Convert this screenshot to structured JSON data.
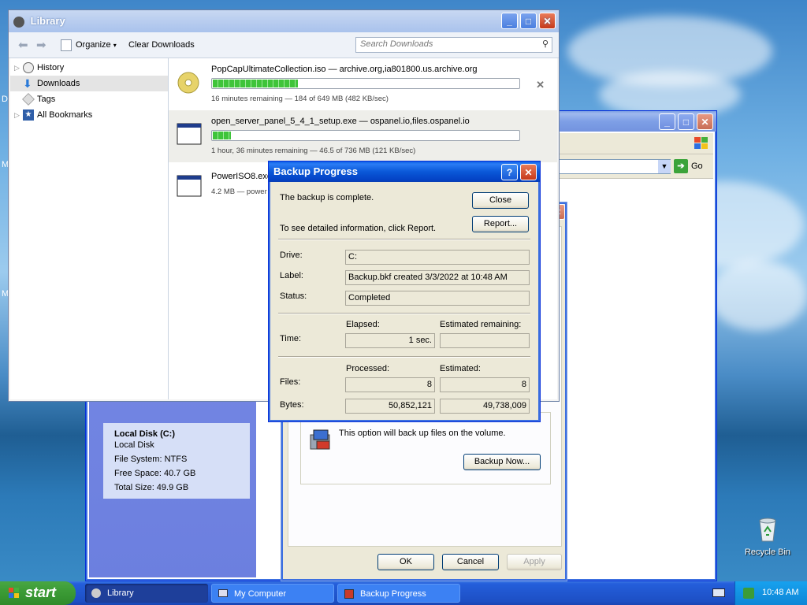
{
  "desktop": {
    "recycle_bin_label": "Recycle Bin",
    "edge_letters": [
      "D",
      "M",
      "M"
    ]
  },
  "library": {
    "title": "Library",
    "toolbar": {
      "organize_label": "Organize",
      "clear_downloads_label": "Clear Downloads",
      "search_placeholder": "Search Downloads"
    },
    "sidebar": [
      {
        "label": "History",
        "icon": "clock-icon",
        "selected": false
      },
      {
        "label": "Downloads",
        "icon": "download-arrow-icon",
        "selected": true
      },
      {
        "label": "Tags",
        "icon": "tag-icon",
        "selected": false
      },
      {
        "label": "All Bookmarks",
        "icon": "bookmark-star-icon",
        "selected": false
      }
    ],
    "downloads": [
      {
        "name": "PopCapUltimateCollection.iso — archive.org,ia801800.us.archive.org",
        "status": "16 minutes remaining — 184 of 649 MB (482 KB/sec)",
        "progress": 0.283,
        "icon": "disc-icon"
      },
      {
        "name": "open_server_panel_5_4_1_setup.exe — ospanel.io,files.ospanel.io",
        "status": "1 hour, 36 minutes remaining — 46.5 of 736 MB (121 KB/sec)",
        "progress": 0.063,
        "icon": "application-window-icon"
      },
      {
        "name": "PowerISO8.exe",
        "status": "4.2 MB — power",
        "progress": null,
        "icon": "application-window-icon"
      }
    ]
  },
  "my_computer": {
    "go_label": "Go",
    "disk": {
      "title": "Local Disk (C:)",
      "type": "Local Disk",
      "file_system": "File System: NTFS",
      "free_space": "Free Space: 40.7 GB",
      "total_size": "Total Size: 49.9 GB"
    }
  },
  "properties": {
    "backup_text": "This option will back up files on the volume.",
    "backup_now_label": "Backup Now...",
    "ok_label": "OK",
    "cancel_label": "Cancel",
    "apply_label": "Apply"
  },
  "backup_dialog": {
    "title": "Backup Progress",
    "complete_text": "The backup is complete.",
    "report_text": "To see detailed information, click Report.",
    "close_label": "Close",
    "report_label": "Report...",
    "drive_label": "Drive:",
    "drive_value": "C:",
    "label_label": "Label:",
    "label_value": "Backup.bkf created 3/3/2022 at 10:48 AM",
    "status_label": "Status:",
    "status_value": "Completed",
    "elapsed_header": "Elapsed:",
    "est_remaining_header": "Estimated remaining:",
    "time_label": "Time:",
    "time_elapsed": "1 sec.",
    "time_remaining": "",
    "processed_header": "Processed:",
    "estimated_header": "Estimated:",
    "files_label": "Files:",
    "files_processed": "8",
    "files_estimated": "8",
    "bytes_label": "Bytes:",
    "bytes_processed": "50,852,121",
    "bytes_estimated": "49,738,009"
  },
  "taskbar": {
    "start_label": "start",
    "tasks": [
      {
        "label": "Library",
        "active": true
      },
      {
        "label": "My Computer",
        "active": false
      },
      {
        "label": "Backup Progress",
        "active": false
      }
    ],
    "clock": "10:48 AM"
  }
}
